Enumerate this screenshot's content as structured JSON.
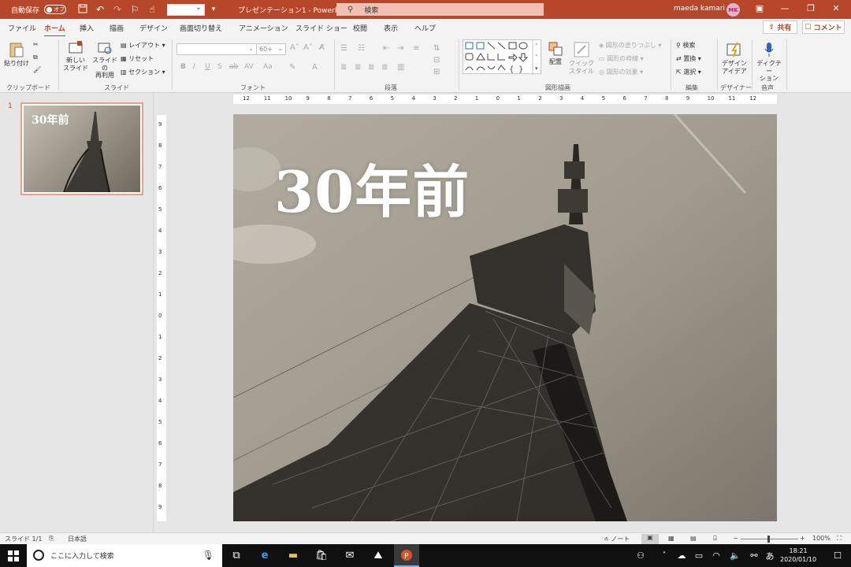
{
  "titlebar": {
    "autosave_label": "自動保存",
    "autosave_state": "オフ",
    "doc_title": "プレゼンテーション1 - PowerPo...",
    "search_placeholder": "検索",
    "user_name": "maeda kamari",
    "user_initials": "MK"
  },
  "tabs": [
    "ファイル",
    "ホーム",
    "挿入",
    "描画",
    "デザイン",
    "画面切り替え",
    "アニメーション",
    "スライド ショー",
    "校閲",
    "表示",
    "ヘルプ"
  ],
  "active_tab": "ホーム",
  "share_label": "共有",
  "comment_label": "コメント",
  "ribbon": {
    "clipboard": {
      "paste": "貼り付け",
      "group": "クリップボード"
    },
    "slides": {
      "new_slide_1": "新しい",
      "new_slide_2": "スライド",
      "reuse_1": "スライドの",
      "reuse_2": "再利用",
      "layout": "レイアウト",
      "reset": "リセット",
      "section": "セクション",
      "group": "スライド"
    },
    "font": {
      "size": "60+",
      "group": "フォント"
    },
    "paragraph": {
      "group": "段落"
    },
    "drawing": {
      "arrange": "配置",
      "quick_1": "クイック",
      "quick_2": "スタイル",
      "fill": "図形の塗りつぶし",
      "outline": "図形の枠線",
      "effect": "図形の効果",
      "group": "図形描画"
    },
    "editing": {
      "find": "検索",
      "replace": "置換",
      "select": "選択",
      "group": "編集"
    },
    "designer": {
      "label_1": "デザイン",
      "label_2": "アイデア",
      "group": "デザイナー"
    },
    "voice": {
      "label_1": "ディクテー",
      "label_2": "ション",
      "group": "音声"
    }
  },
  "thumbnail": {
    "number": "1",
    "title": "30年前"
  },
  "hruler_ticks": [
    "12",
    "11",
    "10",
    "9",
    "8",
    "7",
    "6",
    "5",
    "4",
    "3",
    "2",
    "1",
    "0",
    "1",
    "2",
    "3",
    "4",
    "5",
    "6",
    "7",
    "8",
    "9",
    "10",
    "11",
    "12"
  ],
  "vruler_ticks": [
    "9",
    "8",
    "7",
    "6",
    "5",
    "4",
    "3",
    "2",
    "1",
    "0",
    "1",
    "2",
    "3",
    "4",
    "5",
    "6",
    "7",
    "8",
    "9"
  ],
  "slide": {
    "title": "30年前"
  },
  "statusbar": {
    "slide_info": "スライド 1/1",
    "language": "日本語",
    "notes": "ノート",
    "zoom": "100%"
  },
  "taskbar": {
    "search_placeholder": "ここに入力して検索",
    "time": "18:21",
    "date": "2020/01/10",
    "ime": "あ"
  },
  "colors": {
    "accent": "#b7472a",
    "taskbar": "#101010"
  }
}
